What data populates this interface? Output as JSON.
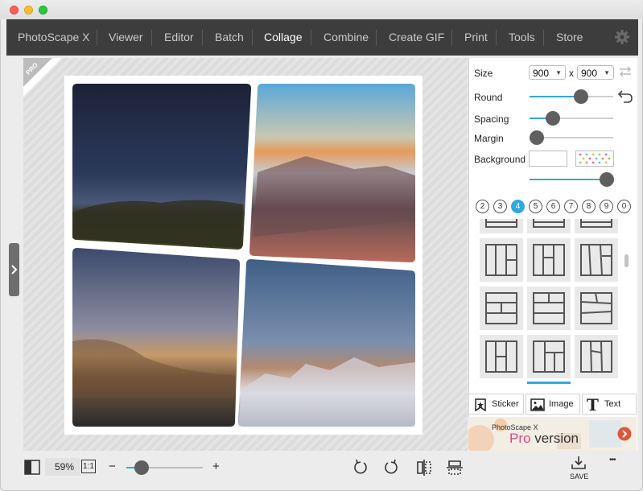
{
  "app": {
    "menu": [
      {
        "label": "PhotoScape X",
        "active": false
      },
      {
        "label": "Viewer",
        "active": false
      },
      {
        "label": "Editor",
        "active": false
      },
      {
        "label": "Batch",
        "active": false
      },
      {
        "label": "Collage",
        "active": true
      },
      {
        "label": "Combine",
        "active": false
      },
      {
        "label": "Create GIF",
        "active": false
      },
      {
        "label": "Print",
        "active": false
      },
      {
        "label": "Tools",
        "active": false
      },
      {
        "label": "Store",
        "active": false
      }
    ],
    "settings_icon": "gear-icon",
    "pro_badge": "PRO"
  },
  "panel": {
    "size_label": "Size",
    "width_value": "900",
    "height_value": "900",
    "size_separator": "x",
    "round_label": "Round",
    "spacing_label": "Spacing",
    "margin_label": "Margin",
    "background_label": "Background",
    "round_level": 0.62,
    "spacing_level": 0.28,
    "margin_level": 0.0,
    "background_opacity_level": 1.0,
    "photo_counts": [
      "2",
      "3",
      "4",
      "5",
      "6",
      "7",
      "8",
      "9",
      "0"
    ],
    "active_count": "4"
  },
  "tools": {
    "sticker_label": "Sticker",
    "image_label": "Image",
    "text_label": "Text",
    "text_glyph": "T"
  },
  "promo": {
    "title": "PhotoScape X",
    "highlight": "Pro",
    "rest": "version"
  },
  "bottom": {
    "zoom": "59%",
    "one_to_one": "1:1",
    "minus": "−",
    "plus": "+",
    "zoom_level": 0.2,
    "save_label": "SAVE",
    "more": "•••"
  },
  "colors": {
    "accent": "#2fa9e0",
    "menubar": "#3d3d3d",
    "promo_pink": "#e0458a"
  }
}
